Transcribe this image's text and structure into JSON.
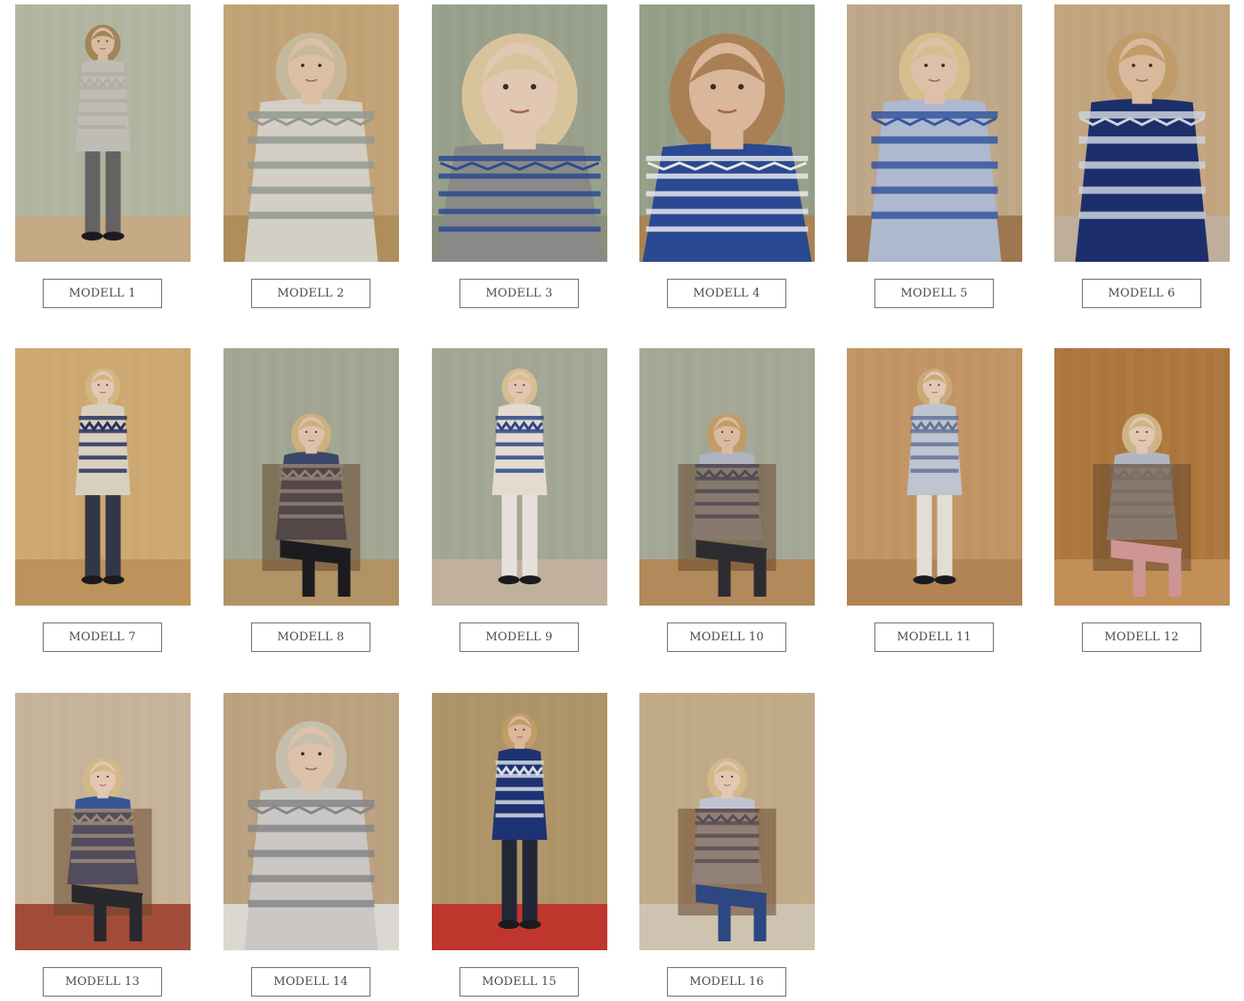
{
  "models": [
    {
      "label": "MODELL 1",
      "bg": "#b8bca6",
      "floor": "#cdb08a",
      "sweater": "#c7c3bd",
      "pattern": "#b9b4ad",
      "skin": "#e2c3a8",
      "hair": "#a88a5c",
      "pants": "#6a6866",
      "shot": "full"
    },
    {
      "label": "MODELL 2",
      "bg": "#c9a878",
      "floor": "#b7945f",
      "sweater": "#dcd8cd",
      "pattern": "#9aa097",
      "skin": "#e6c7ac",
      "hair": "#cfc0a2",
      "pants": "#b9b2a4",
      "shot": "half"
    },
    {
      "label": "MODELL 3",
      "bg": "#9ea690",
      "floor": "#8f967f",
      "sweater": "#8f8f8d",
      "pattern": "#2f4e96",
      "skin": "#ecd0bb",
      "hair": "#e1cda3",
      "pants": "#8f8f8d",
      "shot": "close"
    },
    {
      "label": "MODELL 4",
      "bg": "#9aa48c",
      "floor": "#b08a58",
      "sweater": "#2b4c9a",
      "pattern": "#f1f1f3",
      "skin": "#e3bfa2",
      "hair": "#b08658",
      "pants": "#2b4c9a",
      "shot": "close"
    },
    {
      "label": "MODELL 5",
      "bg": "#c5ad8c",
      "floor": "#a57c52",
      "sweater": "#b6c0d8",
      "pattern": "#3a5aa6",
      "skin": "#e8c8b0",
      "hair": "#e0c592",
      "pants": "#b6c0d8",
      "shot": "half"
    },
    {
      "label": "MODELL 6",
      "bg": "#c9ab84",
      "floor": "#c6b6a2",
      "sweater": "#1f3170",
      "pattern": "#d6dbe6",
      "skin": "#e2c0a3",
      "hair": "#c8a36e",
      "pants": "#c3c7cf",
      "shot": "half"
    },
    {
      "label": "MODELL 7",
      "bg": "#d5ae74",
      "floor": "#c49a5e",
      "sweater": "#e2d8c7",
      "pattern": "#2a3460",
      "skin": "#ecd1bc",
      "hair": "#dbbe86",
      "pants": "#353a4a",
      "shot": "full"
    },
    {
      "label": "MODELL 8",
      "bg": "#a7ab97",
      "floor": "#b9996a",
      "sweater": "#3e4a6e",
      "pattern": "#c8ccd8",
      "skin": "#e6c9b1",
      "hair": "#d6b884",
      "pants": "#1e1e22",
      "shot": "seated"
    },
    {
      "label": "MODELL 9",
      "bg": "#a7ad9a",
      "floor": "#c8b8a4",
      "sweater": "#efe3d8",
      "pattern": "#2e4a8e",
      "skin": "#eccfbb",
      "hair": "#e0c596",
      "pants": "#f1ebe6",
      "shot": "full"
    },
    {
      "label": "MODELL 10",
      "bg": "#a9ae9c",
      "floor": "#b98f5e",
      "sweater": "#b7bcc8",
      "pattern": "#334f8e",
      "skin": "#e4c3a6",
      "hair": "#c9a36c",
      "pants": "#2f2f34",
      "shot": "seated"
    },
    {
      "label": "MODELL 11",
      "bg": "#c99a66",
      "floor": "#b98a58",
      "sweater": "#c6ccd9",
      "pattern": "#6a7a9e",
      "skin": "#ecd0bb",
      "hair": "#d3b07c",
      "pants": "#ece6de",
      "shot": "full"
    },
    {
      "label": "MODELL 12",
      "bg": "#b37a3e",
      "floor": "#c9955a",
      "sweater": "#b8bdc9",
      "pattern": "#9aa0b0",
      "skin": "#ecd0bb",
      "hair": "#d7bc8a",
      "pants": "#d69c9a",
      "shot": "seated"
    },
    {
      "label": "MODELL 13",
      "bg": "#cfbaa0",
      "floor": "#a8503c",
      "sweater": "#3b5a9e",
      "pattern": "#e6e3dd",
      "skin": "#ecd0bb",
      "hair": "#dcc08e",
      "pants": "#2a2a30",
      "shot": "seated"
    },
    {
      "label": "MODELL 14",
      "bg": "#c2a784",
      "floor": "#e4e0da",
      "sweater": "#d3d0cc",
      "pattern": "#8c8c8c",
      "skin": "#e6c9b1",
      "hair": "#cfc6b4",
      "pants": "#1c1c1e",
      "shot": "half"
    },
    {
      "label": "MODELL 15",
      "bg": "#b59a6a",
      "floor": "#c7392f",
      "sweater": "#1f3578",
      "pattern": "#e1e4ea",
      "skin": "#e3c0a3",
      "hair": "#c9a36c",
      "pants": "#24293a",
      "shot": "full"
    },
    {
      "label": "MODELL 16",
      "bg": "#c7b08c",
      "floor": "#d6cbb8",
      "sweater": "#c9ced8",
      "pattern": "#45588f",
      "skin": "#ecd0bb",
      "hair": "#dcc08e",
      "pants": "#2e4a88",
      "shot": "seated"
    }
  ]
}
